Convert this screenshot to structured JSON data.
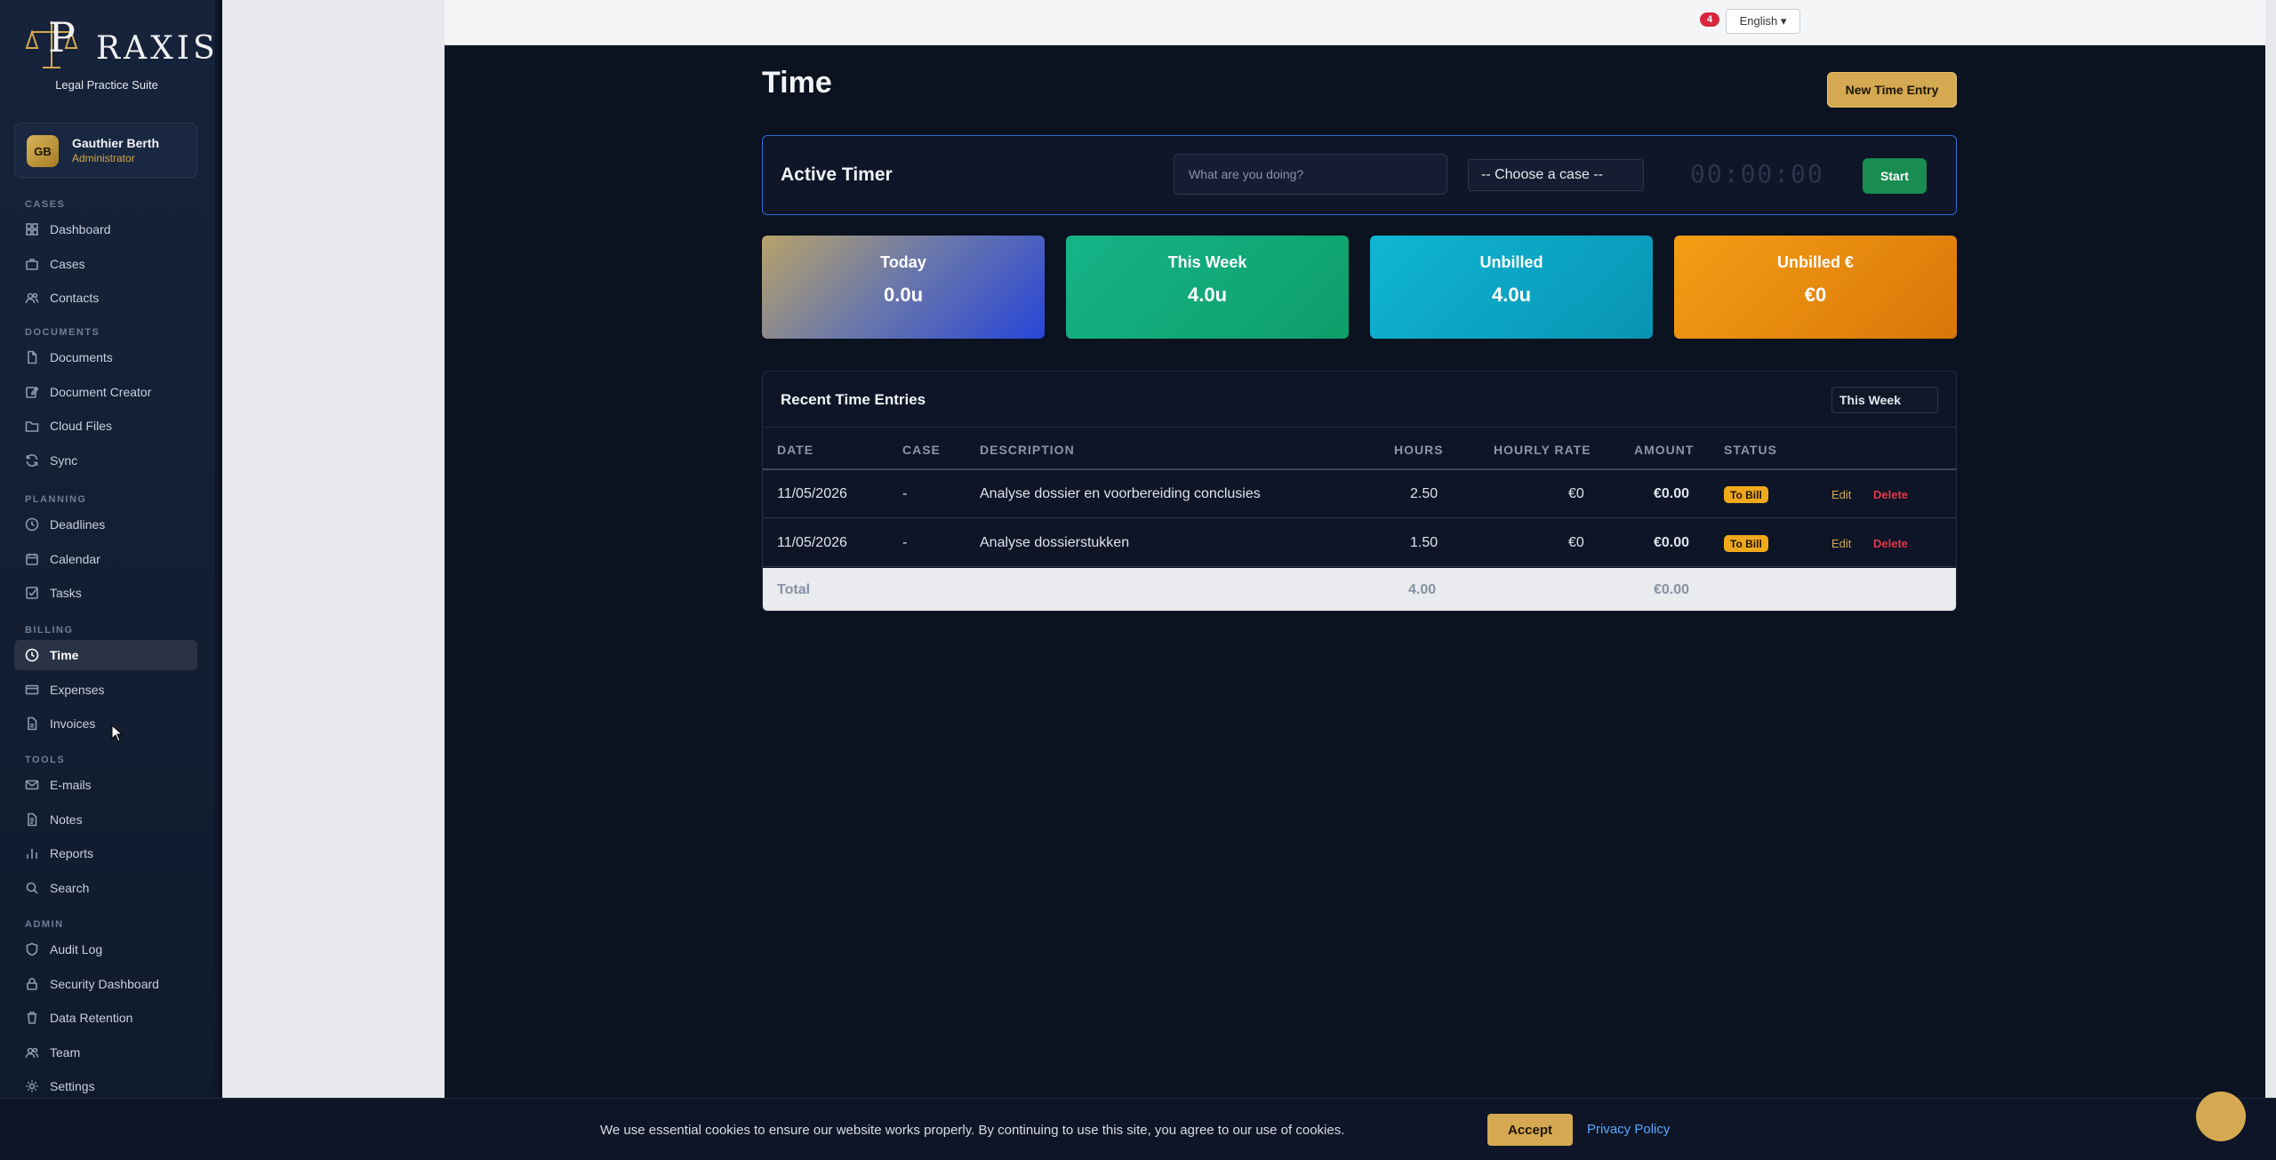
{
  "brand": {
    "logo_text": "RAXIS",
    "subtitle": "Legal Practice Suite"
  },
  "user": {
    "initials": "GB",
    "name": "Gauthier Berth",
    "role": "Administrator"
  },
  "sidebar": {
    "sections": [
      {
        "label": "CASES",
        "items": [
          {
            "label": "Dashboard",
            "icon": "grid-icon"
          },
          {
            "label": "Cases",
            "icon": "briefcase-icon"
          },
          {
            "label": "Contacts",
            "icon": "users-icon"
          }
        ]
      },
      {
        "label": "DOCUMENTS",
        "items": [
          {
            "label": "Documents",
            "icon": "file-icon"
          },
          {
            "label": "Document Creator",
            "icon": "edit-icon"
          },
          {
            "label": "Cloud Files",
            "icon": "folder-icon"
          },
          {
            "label": "Sync",
            "icon": "refresh-icon"
          }
        ]
      },
      {
        "label": "PLANNING",
        "items": [
          {
            "label": "Deadlines",
            "icon": "clock-icon"
          },
          {
            "label": "Calendar",
            "icon": "calendar-icon"
          },
          {
            "label": "Tasks",
            "icon": "check-square-icon"
          }
        ]
      },
      {
        "label": "BILLING",
        "items": [
          {
            "label": "Time",
            "icon": "clock-icon",
            "active": true
          },
          {
            "label": "Expenses",
            "icon": "card-icon"
          },
          {
            "label": "Invoices",
            "icon": "invoice-icon"
          }
        ]
      },
      {
        "label": "TOOLS",
        "items": [
          {
            "label": "E-mails",
            "icon": "mail-icon"
          },
          {
            "label": "Notes",
            "icon": "note-icon"
          },
          {
            "label": "Reports",
            "icon": "bar-chart-icon"
          },
          {
            "label": "Search",
            "icon": "search-icon"
          }
        ]
      },
      {
        "label": "ADMIN",
        "items": [
          {
            "label": "Audit Log",
            "icon": "shield-icon"
          },
          {
            "label": "Security Dashboard",
            "icon": "lock-icon"
          },
          {
            "label": "Data Retention",
            "icon": "trash-icon"
          },
          {
            "label": "Team",
            "icon": "users-icon"
          },
          {
            "label": "Settings",
            "icon": "gear-icon"
          }
        ]
      }
    ]
  },
  "topbar": {
    "notification_count": "4",
    "language": "English ▾"
  },
  "page": {
    "title": "Time",
    "new_entry_label": "New Time Entry"
  },
  "timer": {
    "title": "Active Timer",
    "input_placeholder": "What are you doing?",
    "case_select": "-- Choose a case --",
    "clock": "00:00:00",
    "start_label": "Start"
  },
  "stats": {
    "today": {
      "label": "Today",
      "value": "0.0u"
    },
    "week": {
      "label": "This Week",
      "value": "4.0u"
    },
    "unbilled": {
      "label": "Unbilled",
      "value": "4.0u"
    },
    "unbilled_eur": {
      "label": "Unbilled €",
      "value": "€0"
    }
  },
  "entries": {
    "title": "Recent Time Entries",
    "period": "This Week",
    "columns": [
      "DATE",
      "CASE",
      "DESCRIPTION",
      "HOURS",
      "HOURLY RATE",
      "AMOUNT",
      "STATUS"
    ],
    "rows": [
      {
        "date": "11/05/2026",
        "case": "-",
        "description": "Analyse dossier en voorbereiding conclusies",
        "hours": "2.50",
        "rate": "€0",
        "amount": "€0.00",
        "status": "To Bill",
        "edit": "Edit",
        "delete": "Delete"
      },
      {
        "date": "11/05/2026",
        "case": "-",
        "description": "Analyse dossierstukken",
        "hours": "1.50",
        "rate": "€0",
        "amount": "€0.00",
        "status": "To Bill",
        "edit": "Edit",
        "delete": "Delete"
      }
    ],
    "total": {
      "label": "Total",
      "hours": "4.00",
      "amount": "€0.00"
    }
  },
  "cookie": {
    "text": "We use essential cookies to ensure our website works properly. By continuing to use this site, you agree to our use of cookies.",
    "accept": "Accept",
    "privacy": "Privacy Policy"
  },
  "colors": {
    "accent_gold": "#d4a951",
    "timer_border": "#3468d8",
    "start_green": "#1a8c52",
    "status_badge": "#f0a81c",
    "delete_red": "#e0374c"
  }
}
